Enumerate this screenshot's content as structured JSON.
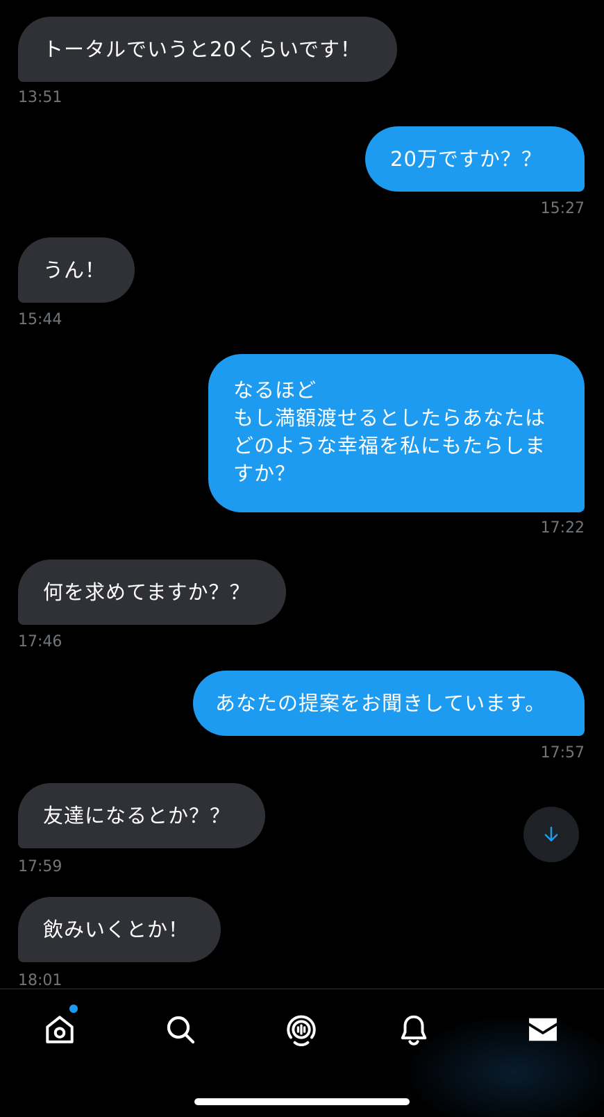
{
  "messages": [
    {
      "side": "in",
      "text": "トータルでいうと20くらいです！",
      "time": "13:51"
    },
    {
      "side": "out",
      "text": "20万ですか？？",
      "time": "15:27"
    },
    {
      "side": "in",
      "text": "うん！",
      "time": "15:44"
    },
    {
      "side": "out",
      "text": "なるほど\nもし満額渡せるとしたらあなたは\nどのような幸福を私にもたらしま\nすか？",
      "time": "17:22"
    },
    {
      "side": "in",
      "text": "何を求めてますか？？",
      "time": "17:46"
    },
    {
      "side": "out",
      "text": "あなたの提案をお聞きしています。",
      "time": "17:57"
    },
    {
      "side": "in",
      "text": "友達になるとか？？",
      "time": "17:59"
    },
    {
      "side": "in",
      "text": "飲みいくとか！",
      "time": "18:01"
    }
  ],
  "scroll_button": {
    "icon": "arrow-down-icon"
  },
  "tabbar": {
    "tabs": [
      {
        "name": "home",
        "icon": "home-icon",
        "has_notification_dot": true
      },
      {
        "name": "search",
        "icon": "search-icon"
      },
      {
        "name": "spaces",
        "icon": "spaces-icon"
      },
      {
        "name": "notifications",
        "icon": "bell-icon"
      },
      {
        "name": "messages",
        "icon": "mail-icon",
        "active": true
      }
    ]
  },
  "colors": {
    "background": "#000000",
    "incoming_bubble": "#2f3136",
    "outgoing_bubble": "#1d9bf0",
    "timestamp": "#71767b",
    "accent": "#1d9bf0"
  }
}
